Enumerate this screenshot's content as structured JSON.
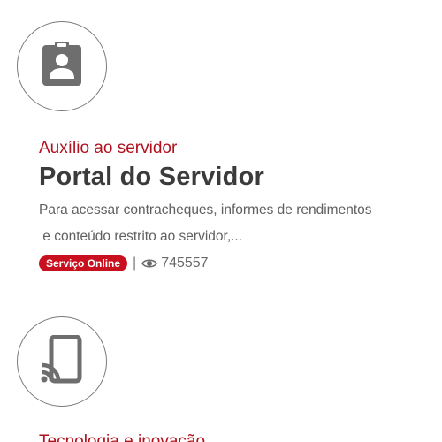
{
  "cards": [
    {
      "icon": "id-badge-icon",
      "category": "Auxílio ao servidor",
      "title": "Portal do Servidor",
      "description_line1": "Para acessar contracheques, informes de rendimentos",
      "description_line2": " e conteúdo restrito ao servidor,...",
      "badge": "Serviço Online",
      "separator": "|",
      "views": "745557"
    },
    {
      "icon": "phone-cast-icon",
      "category": "Tecnologia e inovação"
    }
  ],
  "colors": {
    "accent": "#b0121d",
    "badge_bg": "#c8101e",
    "icon": "#6e6e6e",
    "title": "#3b3b3b"
  }
}
